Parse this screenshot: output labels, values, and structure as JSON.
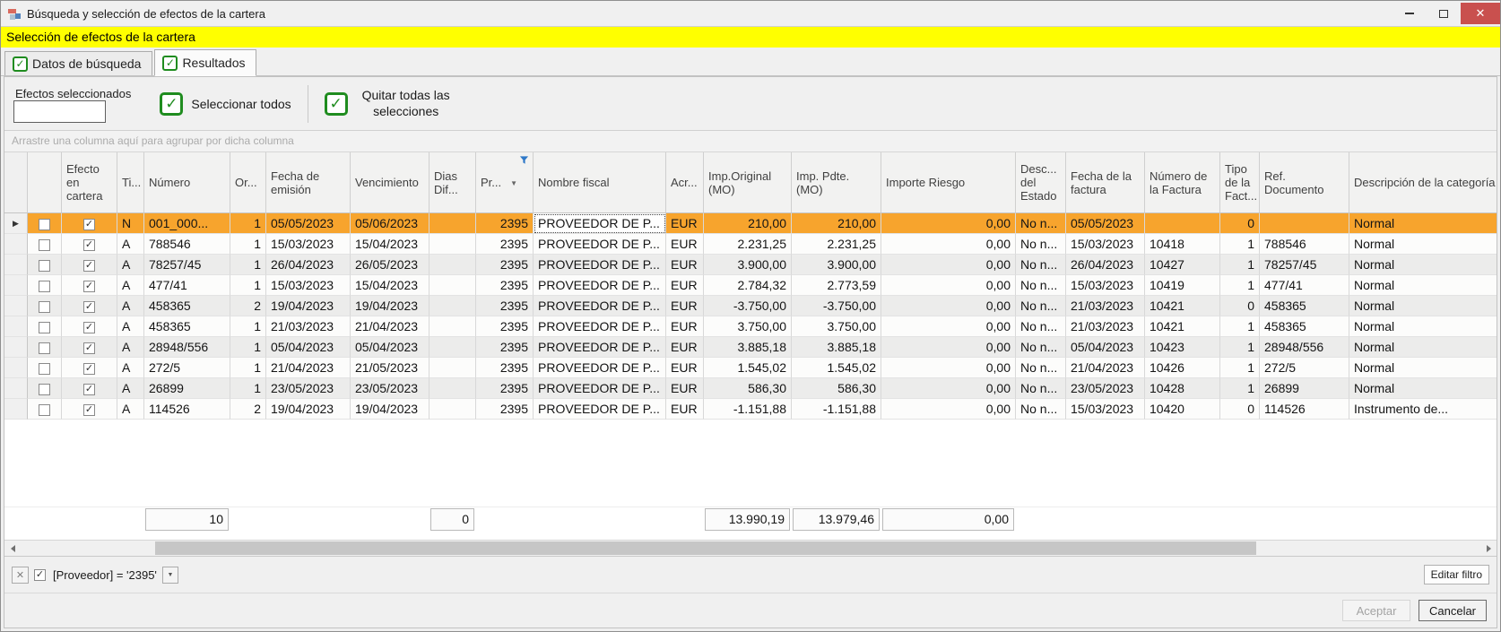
{
  "window": {
    "title": "Búsqueda y selección de efectos de la cartera"
  },
  "banner": "Selección de efectos de la cartera",
  "tabs": [
    {
      "label": "Datos de búsqueda",
      "active": false
    },
    {
      "label": "Resultados",
      "active": true
    }
  ],
  "toolbar": {
    "selected_count_label": "Efectos seleccionados",
    "selected_count_value": "",
    "select_all_label": "Seleccionar todos",
    "clear_all_label": "Quitar todas las selecciones"
  },
  "grid": {
    "group_hint": "Arrastre una columna aquí para agrupar por dicha columna",
    "columns": [
      "",
      "",
      "Efecto en cartera",
      "Ti...",
      "Número",
      "Or...",
      "Fecha de emisión",
      "Vencimiento",
      "Dias Dif...",
      "Pr...",
      "Nombre fiscal",
      "Acr...",
      "Imp.Original (MO)",
      "Imp. Pdte. (MO)",
      "Importe Riesgo",
      "Desc... del Estado",
      "Fecha de la factura",
      "Número de la Factura",
      "Tipo de la Fact...",
      "Ref. Documento",
      "Descripción de la categoría"
    ],
    "rows": [
      {
        "selected": true,
        "row_check": false,
        "efecto_check": true,
        "cells": [
          "N",
          "001_000...",
          "1",
          "05/05/2023",
          "05/06/2023",
          "",
          "2395",
          "PROVEEDOR DE P...",
          "EUR",
          "210,00",
          "210,00",
          "0,00",
          "No n...",
          "05/05/2023",
          "",
          "0",
          "",
          "Normal"
        ]
      },
      {
        "selected": false,
        "row_check": false,
        "efecto_check": true,
        "cells": [
          "A",
          "788546",
          "1",
          "15/03/2023",
          "15/04/2023",
          "",
          "2395",
          "PROVEEDOR DE P...",
          "EUR",
          "2.231,25",
          "2.231,25",
          "0,00",
          "No n...",
          "15/03/2023",
          "10418",
          "1",
          "788546",
          "Normal"
        ]
      },
      {
        "selected": false,
        "row_check": false,
        "efecto_check": true,
        "cells": [
          "A",
          "78257/45",
          "1",
          "26/04/2023",
          "26/05/2023",
          "",
          "2395",
          "PROVEEDOR DE P...",
          "EUR",
          "3.900,00",
          "3.900,00",
          "0,00",
          "No n...",
          "26/04/2023",
          "10427",
          "1",
          "78257/45",
          "Normal"
        ]
      },
      {
        "selected": false,
        "row_check": false,
        "efecto_check": true,
        "cells": [
          "A",
          "477/41",
          "1",
          "15/03/2023",
          "15/04/2023",
          "",
          "2395",
          "PROVEEDOR DE P...",
          "EUR",
          "2.784,32",
          "2.773,59",
          "0,00",
          "No n...",
          "15/03/2023",
          "10419",
          "1",
          "477/41",
          "Normal"
        ]
      },
      {
        "selected": false,
        "row_check": false,
        "efecto_check": true,
        "cells": [
          "A",
          "458365",
          "2",
          "19/04/2023",
          "19/04/2023",
          "",
          "2395",
          "PROVEEDOR DE P...",
          "EUR",
          "-3.750,00",
          "-3.750,00",
          "0,00",
          "No n...",
          "21/03/2023",
          "10421",
          "0",
          "458365",
          "Normal"
        ]
      },
      {
        "selected": false,
        "row_check": false,
        "efecto_check": true,
        "cells": [
          "A",
          "458365",
          "1",
          "21/03/2023",
          "21/04/2023",
          "",
          "2395",
          "PROVEEDOR DE P...",
          "EUR",
          "3.750,00",
          "3.750,00",
          "0,00",
          "No n...",
          "21/03/2023",
          "10421",
          "1",
          "458365",
          "Normal"
        ]
      },
      {
        "selected": false,
        "row_check": false,
        "efecto_check": true,
        "cells": [
          "A",
          "28948/556",
          "1",
          "05/04/2023",
          "05/04/2023",
          "",
          "2395",
          "PROVEEDOR DE P...",
          "EUR",
          "3.885,18",
          "3.885,18",
          "0,00",
          "No n...",
          "05/04/2023",
          "10423",
          "1",
          "28948/556",
          "Normal"
        ]
      },
      {
        "selected": false,
        "row_check": false,
        "efecto_check": true,
        "cells": [
          "A",
          "272/5",
          "1",
          "21/04/2023",
          "21/05/2023",
          "",
          "2395",
          "PROVEEDOR DE P...",
          "EUR",
          "1.545,02",
          "1.545,02",
          "0,00",
          "No n...",
          "21/04/2023",
          "10426",
          "1",
          "272/5",
          "Normal"
        ]
      },
      {
        "selected": false,
        "row_check": false,
        "efecto_check": true,
        "cells": [
          "A",
          "26899",
          "1",
          "23/05/2023",
          "23/05/2023",
          "",
          "2395",
          "PROVEEDOR DE P...",
          "EUR",
          "586,30",
          "586,30",
          "0,00",
          "No n...",
          "23/05/2023",
          "10428",
          "1",
          "26899",
          "Normal"
        ]
      },
      {
        "selected": false,
        "row_check": false,
        "efecto_check": true,
        "cells": [
          "A",
          "114526",
          "2",
          "19/04/2023",
          "19/04/2023",
          "",
          "2395",
          "PROVEEDOR DE P...",
          "EUR",
          "-1.151,88",
          "-1.151,88",
          "0,00",
          "No n...",
          "15/03/2023",
          "10420",
          "0",
          "114526",
          "Instrumento de..."
        ]
      }
    ],
    "summary": {
      "numero": "10",
      "dias": "0",
      "imporig": "13.990,19",
      "imppdte": "13.979,46",
      "riesgo": "0,00"
    }
  },
  "filter": {
    "expression": "[Proveedor] = '2395'",
    "enabled": true,
    "edit_button_label": "Editar filtro"
  },
  "footer": {
    "accept_label": "Aceptar",
    "cancel_label": "Cancelar"
  },
  "icons": {
    "close": "✕",
    "check": "✓",
    "caret": "▼",
    "row_arrow": "▶",
    "filter_funnel": "funnel"
  },
  "colors": {
    "selection_orange": "#F7A42D",
    "checkbox_column_lavender": "#CBCBF2",
    "close_button_red": "#C9504E",
    "check_green": "#1F8C1F",
    "banner_yellow": "#FFFF00"
  }
}
